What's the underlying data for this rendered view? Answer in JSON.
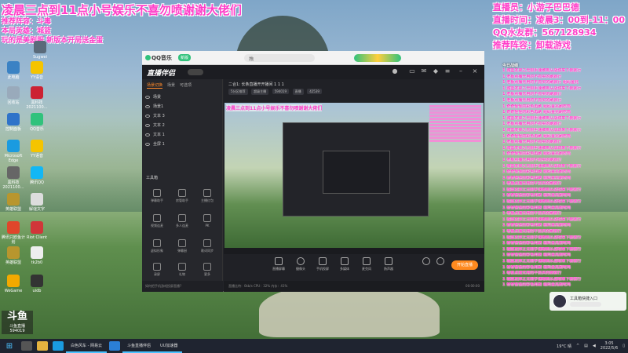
{
  "overlay": {
    "title": "凌晨三点到11点小号娱乐不喜勿喷谢谢大佬们",
    "left_lines": [
      "推荐阵容：斗毒",
      "本局英雄：城篮",
      "玩的是美剧服  新版本开局送金蛋"
    ],
    "right_lines": [
      "直播员：小游子巴巴德",
      "直播时间：凌晨3：00到-11：00",
      "QQ水友群：567128934",
      "推荐阵容：卸载游戏"
    ]
  },
  "desktop_icons": [
    "Sugwei",
    "此电脑",
    "YY语音",
    "回收站",
    "控制面板",
    "QQ音乐",
    "Microsoft Edge",
    "YY语音",
    "黑科技2021100…",
    "腾讯QQ",
    "英雄联盟",
    "解谜文字",
    "腾讯只欧鱼计划",
    "Riot Client",
    "英雄联盟",
    "WeGame",
    "UU加速器",
    "uidb",
    "斗鱼直播",
    "tk2b0"
  ],
  "qq_window": {
    "app_name": "QQ音乐",
    "badge": "新版",
    "search_text": "烛"
  },
  "app": {
    "logo": "直播伴侣",
    "sidebar_tabs": [
      "场景切换",
      "场景",
      "可选项"
    ],
    "scenes": [
      "场景",
      "场景1",
      "文本 3",
      "文本 2",
      "文本 1",
      "全屏 1"
    ],
    "tools_title": "工具箱",
    "tools": [
      "弹幕助手",
      "房管助手",
      "主播红包",
      "视频连麦",
      "多人连麦",
      "PK",
      "虚拟形象",
      "弹幕厨",
      "歌词同步",
      "录屏",
      "礼物",
      "更多"
    ],
    "sidebar_bottom": "如何把手机游戏投屏直播?",
    "header_title": "二合1: 长条直播开开播间 1 1 1",
    "header_pills": [
      "5分区推荐",
      "超级主播",
      "594019",
      "直播",
      "42539"
    ],
    "controls": [
      "直播屏幕",
      "摄像头",
      "手机投屏",
      "多媒体",
      "麦克风",
      "扬声器"
    ],
    "start_live": "开始直播",
    "status": "直播比特：0kb/s  CPU：32%  内存：41%",
    "status_right": "00:00:00"
  },
  "preview": {
    "title": "凌晨三点到11点小号娱乐不喜勿喷谢谢大佬们"
  },
  "chat": {
    "title": "今日战绩",
    "lines": [
      "1  城篮发掉之无限手速维到从战球来下装就行",
      "1  老板点播无用的不抓买的刷就行",
      "1  老板点播无用的不抓买的刷就行 组码金兆",
      "1  城篮发掉之无限手速维到从战球来下装就行",
      "1  老板点播无用的不抓买的刷就行",
      "1  老板点播无用的不抓买的刷就行",
      "1  奇奇怪怪的彩色再刷 组码金兆刷吃鸡",
      "1  奇奇怪怪的彩色再刷 组码金兆刷吃鸡",
      "1  城篮发掉之无限手速维到从战球来下装就行",
      "1  老板点播无用的不抓买的刷就行",
      "1  城篮发掉之无限手速维到从战球来下装就行",
      "1  奇奇怪怪的彩色再刷 组码金兆刷吃鸡",
      "1  老板点播无用的不抓买的刷就行",
      "1  城篮发掉之无限手速维到从战球来下装就行",
      "1  奇奇怪怪的彩色再刷 组码金兆刷吃鸡",
      "1  老板点播无用的不抓买的刷就行",
      "1  城篮发掉之无限手速维到从战球来下装就行",
      "1  奇奇怪怪的彩色再刷 组码金兆刷吃鸡",
      "1  奇奇怪怪的彩色再刷 组码金兆刷吃鸡",
      "1  老板点播无用的不抓买的刷就行",
      "1  城篮发掉之无限手速维到从战球来下装就行",
      "1  奇奇怪怪的彩色再刷 组码金兆刷吃鸡",
      "1  城篮发掉之无限手速维到从战球来下装就行",
      "1  奇奇怪怪的彩色再刷 组码金兆刷吃鸡",
      "1  老板点播无用的不抓买的刷就行",
      "1  城篮发掉之无限手速维到从战球来下装就行",
      "1  奇奇怪怪的彩色再刷 组码金兆刷吃鸡",
      "1  老板点播无用的不抓买的刷就行",
      "1  城篮发掉之无限手速维到从战球来下装就行",
      "1  奇奇怪怪的彩色再刷 组码金兆刷吃鸡",
      "1  城篮发掉之无限手速维到从战球来下装就行",
      "1  奇奇怪怪的彩色再刷 组码金兆刷吃鸡",
      "1  城篮发掉之无限手速维到从战球来下装就行",
      "1  奇奇怪怪的彩色再刷 组码金兆刷吃鸡",
      "1  老板点播无用的不抓买的刷就行",
      "1  城篮发掉之无限手速维到从战球来下装就行",
      "1  奇奇怪怪的彩色再刷 组码金兆刷吃鸡"
    ]
  },
  "cam_card": {
    "text": "工具箱快捷入口"
  },
  "uid": {
    "big": "斗鱼",
    "label": "斗鱼直播",
    "number": "594019"
  },
  "taskbar": {
    "items": [
      "白色风车 - 网易云",
      "斗鱼直播伴侣",
      "UU加速器"
    ],
    "weather": "19°C 晴",
    "time": "3:05",
    "date": "2022/5/6"
  }
}
